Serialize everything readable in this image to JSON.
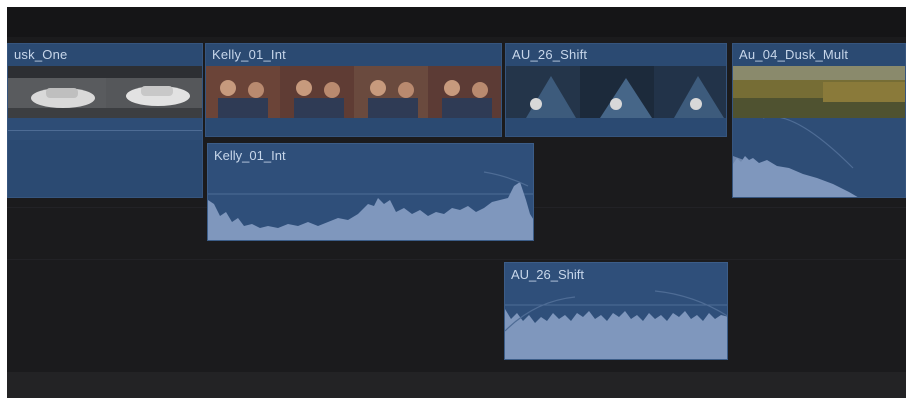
{
  "timeline": {
    "primary_clips": [
      {
        "name": "usk_One"
      },
      {
        "name": "Kelly_01_Int"
      },
      {
        "name": "AU_26_Shift"
      },
      {
        "name": "Au_04_Dusk_Mult"
      }
    ],
    "connected_audio_clips": [
      {
        "name": "Kelly_01_Int"
      },
      {
        "name": "AU_26_Shift"
      }
    ]
  },
  "colors": {
    "clip_fill": "#2b4a72",
    "waveform": "#7f97bd",
    "background": "#1b1b1d"
  }
}
